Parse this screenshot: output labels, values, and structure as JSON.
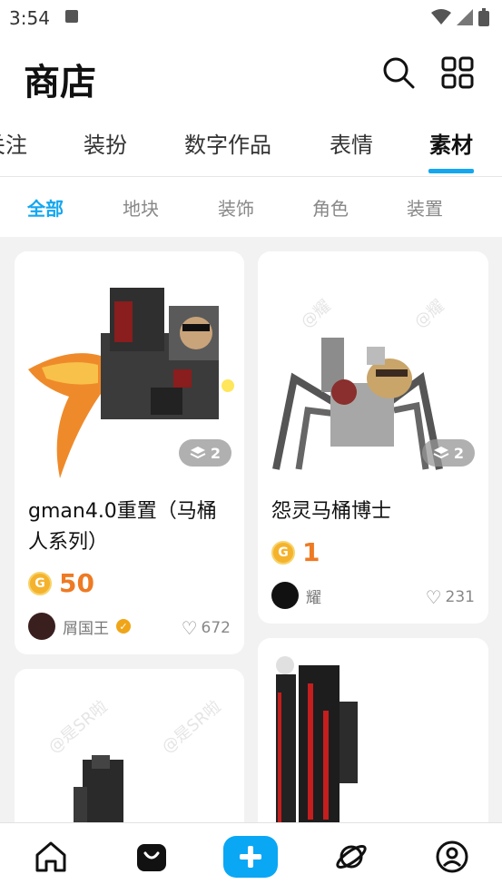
{
  "status_bar": {
    "time": "3:54"
  },
  "header": {
    "title": "商店"
  },
  "tabs": [
    {
      "label": "关注"
    },
    {
      "label": "装扮"
    },
    {
      "label": "数字作品"
    },
    {
      "label": "表情"
    },
    {
      "label": "素材",
      "active": true
    }
  ],
  "subtabs": [
    {
      "label": "全部",
      "active": true
    },
    {
      "label": "地块"
    },
    {
      "label": "装饰"
    },
    {
      "label": "角色"
    },
    {
      "label": "装置"
    }
  ],
  "cards": [
    {
      "name_line1": "gman4.0重置（马桶",
      "name_line2": "人系列）",
      "price": "50",
      "author": "屑国王",
      "likes": "672",
      "layers": "2"
    },
    {
      "name_line1": "怨灵马桶博士",
      "price": "1",
      "author": "耀",
      "likes": "231",
      "layers": "2",
      "watermark": "@耀"
    },
    {
      "watermark": "@是SR啦"
    },
    {}
  ],
  "colors": {
    "accent": "#14a7f0",
    "price": "#ee7a23"
  },
  "bottom_nav": [
    "home-icon",
    "shop-bag-icon",
    "plus-icon",
    "planet-icon",
    "profile-icon"
  ]
}
